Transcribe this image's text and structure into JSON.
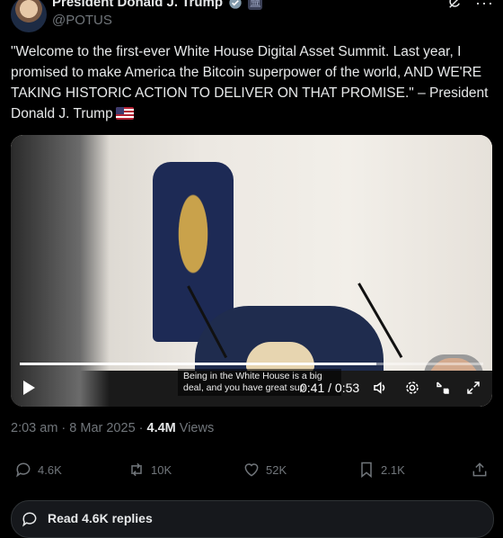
{
  "header": {
    "name": "President Donald J. Trump",
    "handle": "@POTUS"
  },
  "tweet": {
    "text": "\"Welcome to the first-ever White House Digital Asset Summit. Last year, I promised to make America the Bitcoin superpower of the world, AND WE'RE TAKING HISTORIC ACTION TO DELIVER ON THAT PROMISE.\" – President Donald J. Trump",
    "flag_icon": "us-flag-icon"
  },
  "video": {
    "caption": "Being in the White House is a big deal, and you have great sup",
    "time_display": "0:41 / 0:53",
    "progress_fraction": 0.77
  },
  "meta": {
    "time": "2:03 am · 8 Mar 2025 · ",
    "views_count": "4.4M",
    "views_label": " Views"
  },
  "actions": {
    "replies": "4.6K",
    "reposts": "10K",
    "likes": "52K",
    "bookmarks": "2.1K"
  },
  "read_replies_label": "Read 4.6K replies",
  "colors": {
    "background": "#000000",
    "text": "#e7e9ea",
    "muted": "#71767b",
    "verified": "#1d9bf0"
  }
}
